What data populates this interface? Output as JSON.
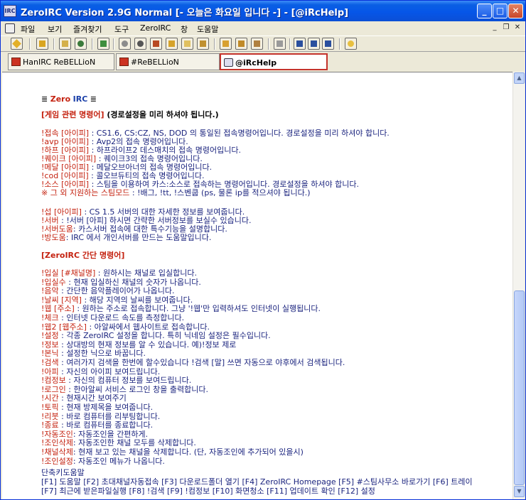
{
  "window": {
    "title": "ZeroIRC Version 2.9G Normal [- 오늘은 화요일 입니다 -] - [@iRcHelp]",
    "app_icon_text": "IRC",
    "minimize": "_",
    "maximize": "□",
    "close": "✕"
  },
  "menu": {
    "items": [
      "파일",
      "보기",
      "즐겨찾기",
      "도구",
      "ZeroIRC",
      "창",
      "도움말"
    ],
    "mdi_minimize": "_",
    "mdi_restore": "❐",
    "mdi_close": "✕"
  },
  "tabs": [
    {
      "label": "HanIRC ReBELLioN",
      "active": false
    },
    {
      "label": "#ReBELLioN",
      "active": false
    },
    {
      "label": "@iRcHelp",
      "active": true
    }
  ],
  "content": {
    "logo": {
      "prefix": "≣ ",
      "zero": "Zero",
      "irc": "IRC",
      "suffix": " ≣"
    },
    "game_header": {
      "label": "[게임 관련 명령어]",
      "note": "  (경로설정을 미리 하셔야 됩니다.)"
    },
    "game_lines": [
      {
        "cmd": "!접속",
        "arg": " [아이피]",
        "desc": " : CS1.6, CS:CZ, NS, DOD 의 통일된 접속명령어입니다. 경로설정을 미리 하셔야 합니다."
      },
      {
        "cmd": "!avp",
        "arg": " [아이피]",
        "desc": " : Avp2의 접속 명령어입니다."
      },
      {
        "cmd": "!하프",
        "arg": " [아이피]",
        "desc": " : 하프라이프2 데스매치의 접속 명령어입니다."
      },
      {
        "cmd": "!퀘이크",
        "arg": " [아이피]",
        "desc": " : 퀘이크3의 접속 명령어입니다."
      },
      {
        "cmd": "!메달",
        "arg": " [아이피]",
        "desc": " : 메달오브아너의 접속 명령어입니다."
      },
      {
        "cmd": "!cod",
        "arg": " [아이피]",
        "desc": " : 콜오브듀티의 접속 명령어입니다."
      },
      {
        "cmd": "!소스",
        "arg": " [아이피]",
        "desc": " : 스팀을 이용하여 카스:소스로 접속하는 명령어입니다. 경로설정을 하셔야 합니다."
      },
      {
        "cmd": "※ 그 외 지원하는 스팀모드",
        "arg": "",
        "desc": " : !배그, !tt, !스벤쿱 (ps, 물론 ip를 적으셔야 됩니다.)"
      }
    ],
    "info_lines": [
      {
        "cmd": "!섭",
        "arg": " [아이피]",
        "desc": " : CS 1.5 서버의 대한 자세한 정보를 보여줍니다."
      },
      {
        "cmd": "!서버",
        "arg": "",
        "desc": " : !서버 [아피] 하시면 간략한 서버정보를 보실수 있습니다."
      },
      {
        "cmd": "!서버도움",
        "arg": "",
        "desc": ": 카스서버 접속에 대한 특수기능을 설명합니다."
      },
      {
        "cmd": "!방도움",
        "arg": "",
        "desc": ": IRC 에서 개인서버를 만드는 도움말입니다."
      }
    ],
    "zero_header": "[ZeroIRC 간단 명령어]",
    "zero_lines": [
      {
        "cmd": "!입실",
        "arg": " [#채널명]",
        "desc": " : 원하시는 채널로 입실합니다."
      },
      {
        "cmd": "!입실수",
        "arg": "",
        "desc": " : 현재 입실하신 채널의 숫자가 나옵니다."
      },
      {
        "cmd": "!음악",
        "arg": "",
        "desc": " : 간단한 음악플레이어가 나옵니다."
      },
      {
        "cmd": "!날씨",
        "arg": " [지역]",
        "desc": " : 해당 지역의 날씨를 보여줍니다."
      },
      {
        "cmd": "!웹",
        "arg": " [주소]",
        "desc": " : 원하는 주소로 접속합니다. 그냥 '!웹'만 입력하셔도 인터넷이 실행됩니다."
      },
      {
        "cmd": "!체크",
        "arg": "",
        "desc": " : 인터넷 다운로드 속도를 측정합니다."
      },
      {
        "cmd": "!웹2",
        "arg": " [웹주소]",
        "desc": " : 아알싸에서 웹사이트로 접속합니다."
      },
      {
        "cmd": "!설정",
        "arg": "",
        "desc": " : 각종 ZeroIRC 설정을 합니다. 특히 닉네임 설정은 필수입니다."
      },
      {
        "cmd": "!정보",
        "arg": "",
        "desc": " : 상대방의 현재 정보를 알 수 있습니다. 예)!정보 제로"
      },
      {
        "cmd": "!본닉",
        "arg": "",
        "desc": " : 설정한 닉으로 바꿉니다."
      },
      {
        "cmd": "!검색",
        "arg": "",
        "desc": " : 여러가지 검색을 한번에 할수있습니다 !검색 [말] 쓰면 자동으로 야후에서 검색됩니다."
      },
      {
        "cmd": "!아피",
        "arg": "",
        "desc": " : 자신의 아이피 보여드립니다."
      },
      {
        "cmd": "!컴정보",
        "arg": "",
        "desc": " : 자신의 컴퓨터 정보를 보여드립니다."
      },
      {
        "cmd": "!로그인",
        "arg": "",
        "desc": " : 한아알씨 서비스 로그인 창을 출력합니다."
      },
      {
        "cmd": "!시간",
        "arg": "",
        "desc": " : 현재시간 보여주기"
      },
      {
        "cmd": "!토픽",
        "arg": "",
        "desc": " : 현재 방제목을 보여줍니다."
      },
      {
        "cmd": "!리붓",
        "arg": "",
        "desc": " : 바로 컴퓨터를 리부팅합니다."
      },
      {
        "cmd": "!종료",
        "arg": "",
        "desc": " : 바로 컴퓨터를 종료합니다."
      },
      {
        "cmd": "!자동조인",
        "arg": "",
        "desc": ": 자동조인을 간편하게."
      },
      {
        "cmd": "!조인삭제",
        "arg": "",
        "desc": ": 자동조인한 채널 모두를 삭제합니다."
      },
      {
        "cmd": "!채널삭제",
        "arg": "",
        "desc": ": 현재 보고 있는 채널을 삭제합니다. (단, 자동조인에 추가되어 있을시)"
      },
      {
        "cmd": "!조인설정",
        "arg": "",
        "desc": ": 자동조인 메뉴가 나옵니다."
      }
    ],
    "shortcut_title": "단축키도움말",
    "shortcut_lines": [
      "[F1] 도움말 [F2] 초대채널자동접속 [F3] 다운로드폴더 열기 [F4] ZeroIRC Homepage [F5] #스팀사무소 바로가기 [F6] 트레이",
      "[F7] 최근에 받은파일실행 [F8] !검색 [F9] !컴정보 [F10] 화면청소 [F11] 업데이트 확인 [F12] 설정"
    ]
  },
  "scrollbar": {
    "up": "▲",
    "down": "▼"
  }
}
